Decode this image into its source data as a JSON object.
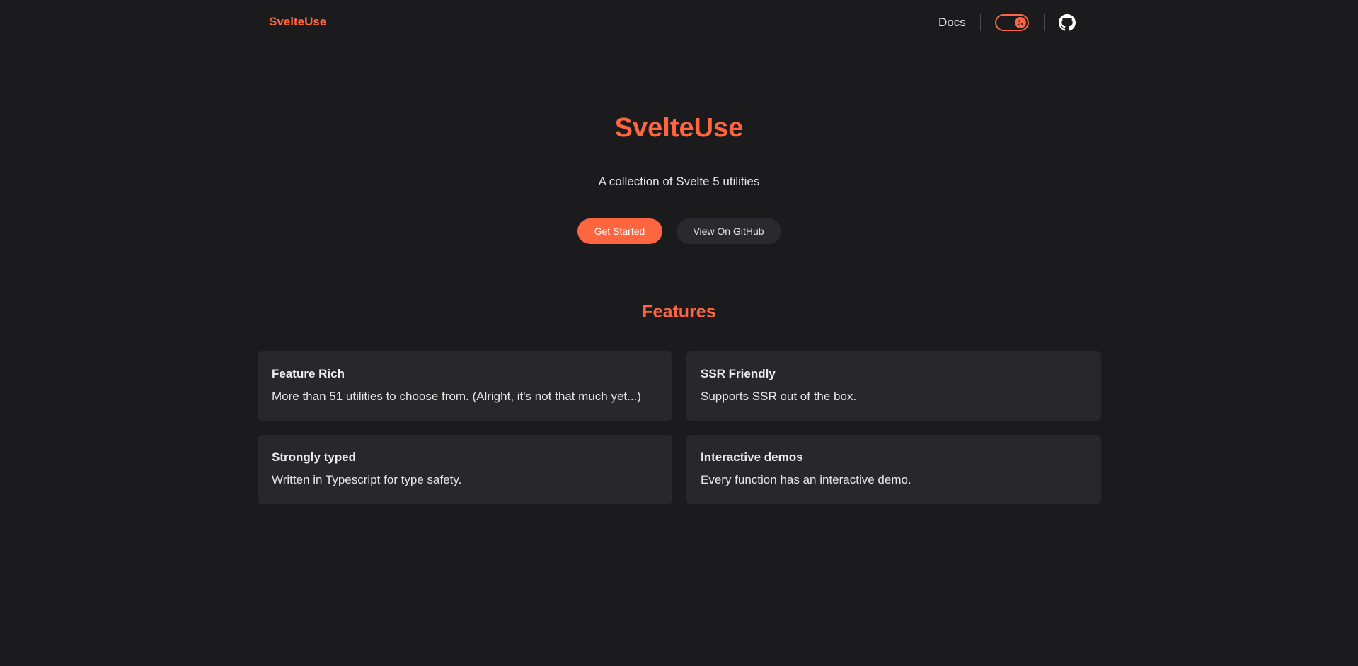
{
  "navbar": {
    "brand": "SvelteUse",
    "docs_label": "Docs",
    "toggle_icon": "moon-icon",
    "github_icon": "github-icon"
  },
  "hero": {
    "title": "SvelteUse",
    "subtitle": "A collection of Svelte 5 utilities",
    "primary_button": "Get Started",
    "secondary_button": "View On GitHub"
  },
  "features": {
    "heading": "Features",
    "items": [
      {
        "title": "Feature Rich",
        "description": "More than 51 utilities to choose from. (Alright, it's not that much yet...)"
      },
      {
        "title": "SSR Friendly",
        "description": "Supports SSR out of the box."
      },
      {
        "title": "Strongly typed",
        "description": "Written in Typescript for type safety."
      },
      {
        "title": "Interactive demos",
        "description": "Every function has an interactive demo."
      }
    ]
  },
  "colors": {
    "accent": "#ff6640",
    "background": "#1b1b1d",
    "card": "#28282b"
  }
}
